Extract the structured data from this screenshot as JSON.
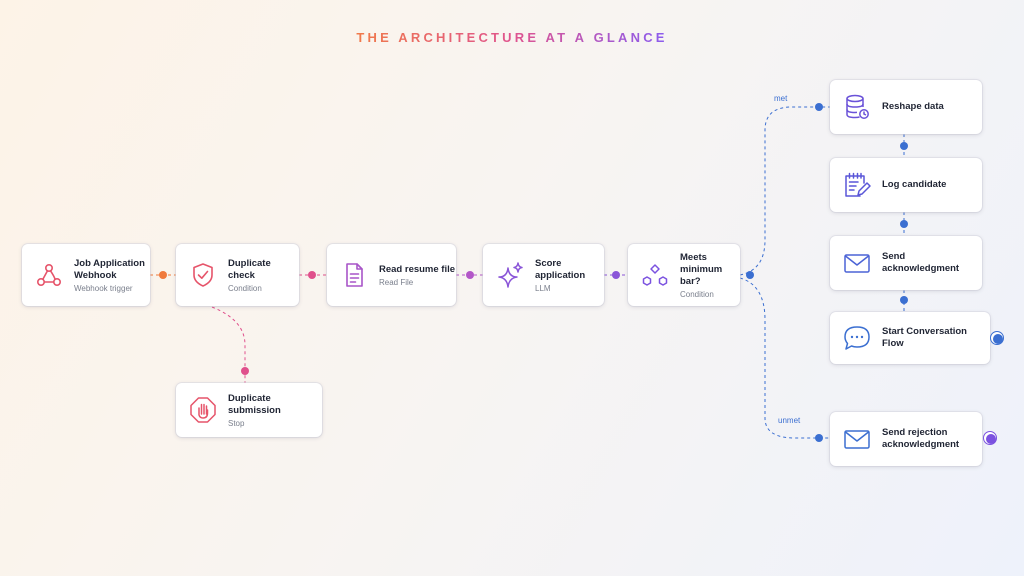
{
  "title": "THE ARCHITECTURE AT A GLANCE",
  "nodes": {
    "webhook": {
      "name": "Job Application Webhook",
      "type": "Webhook trigger"
    },
    "duplicate_check": {
      "name": "Duplicate check",
      "type": "Condition"
    },
    "read_resume": {
      "name": "Read resume file",
      "type": "Read File"
    },
    "score": {
      "name": "Score application",
      "type": "LLM"
    },
    "min_bar": {
      "name": "Meets minimum bar?",
      "type": "Condition"
    },
    "duplicate_submission": {
      "name": "Duplicate submission",
      "type": "Stop"
    },
    "reshape": {
      "name": "Reshape data"
    },
    "log": {
      "name": "Log candidate"
    },
    "ack": {
      "name": "Send acknowledgment"
    },
    "conversation": {
      "name": "Start Conversation Flow"
    },
    "rejection": {
      "name": "Send rejection acknowledgment"
    }
  },
  "edges": {
    "met": "met",
    "unmet": "unmet"
  },
  "colors": {
    "orange": "#f07a3c",
    "pink": "#e0508c",
    "purple": "#9a55d6",
    "violet": "#7b52e0",
    "blue": "#3b6fd1",
    "red": "#e6546a"
  },
  "icons": {
    "webhook": "webhook-icon",
    "duplicate_check": "shield-check-icon",
    "read_resume": "document-icon",
    "score": "sparkle-icon",
    "min_bar": "branch-icon",
    "duplicate_submission": "stop-hand-icon",
    "reshape": "database-icon",
    "log": "notepad-pencil-icon",
    "ack": "envelope-icon",
    "conversation": "chat-bubble-icon",
    "rejection": "envelope-icon"
  }
}
